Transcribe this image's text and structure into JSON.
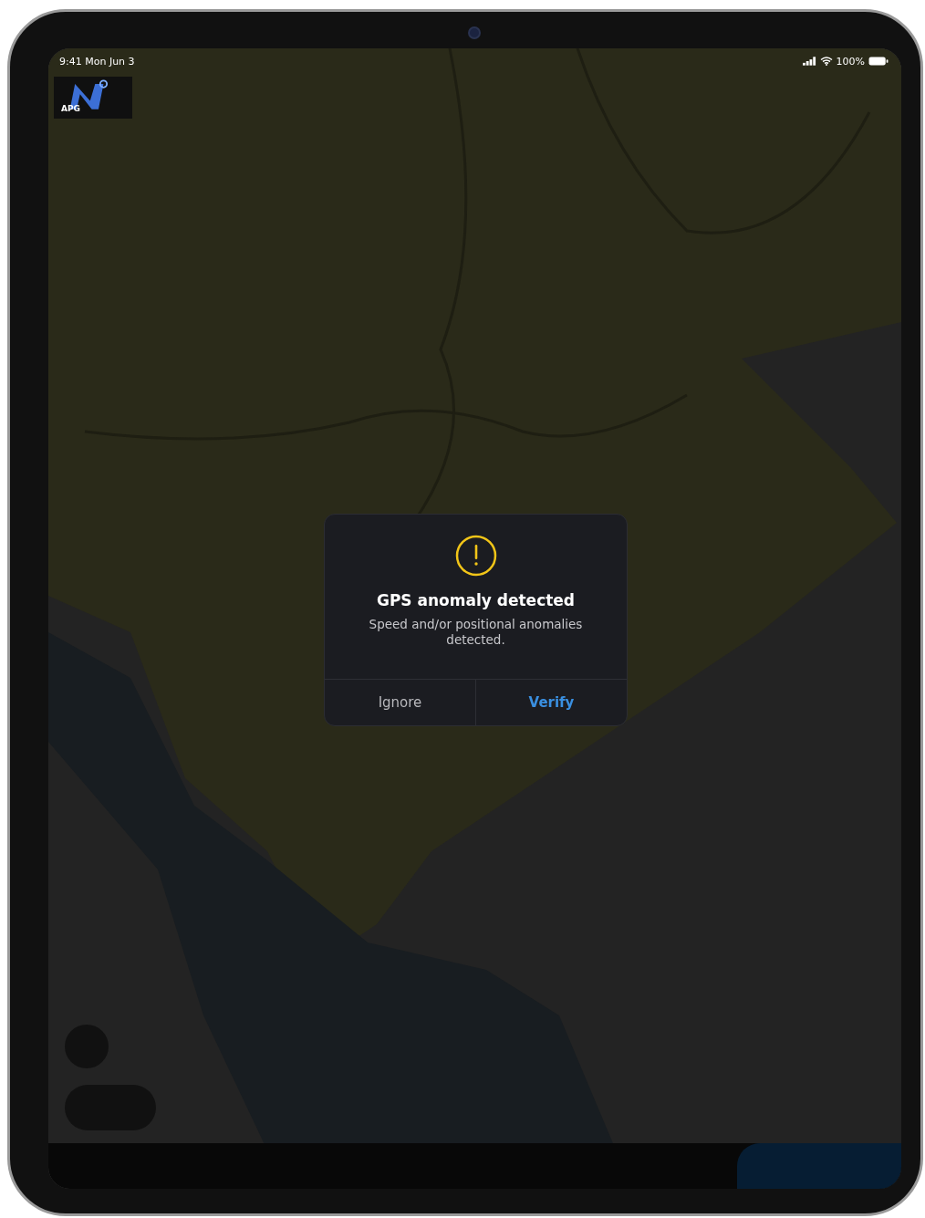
{
  "status_bar": {
    "time": "9:41 Mon Jun 3",
    "battery": "100%"
  },
  "logo": {
    "text": "APG"
  },
  "dialog": {
    "title": "GPS anomaly detected",
    "message": "Speed and/or positional anomalies detected.",
    "buttons": [
      {
        "label": "Ignore",
        "kind": "cancel"
      },
      {
        "label": "Verify",
        "kind": "primary"
      }
    ]
  }
}
